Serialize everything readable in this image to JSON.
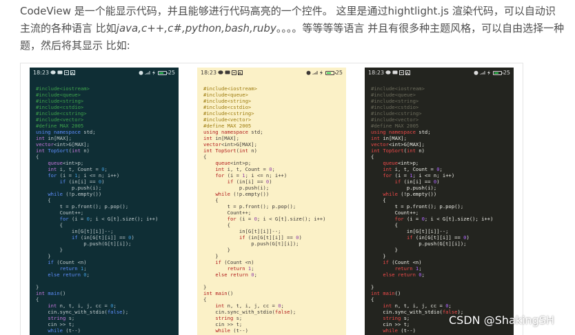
{
  "intro": {
    "line1": "CodeView 是一个能显示代码，并且能够进行代码高亮的一个控件。 这里是通过hightlight.js 渲染代码，可以自动识",
    "line2_start": "主流的各种语言 比如",
    "line2_langs": "java,c++,c#,python,bash,ruby",
    "line2_end": "。。。。等等等等语言 并且有很多种主题风格，可以自由选择一种",
    "line3": "题，然后将其显示 比如:"
  },
  "statusbar": {
    "time": "18:23",
    "battery": "25"
  },
  "code_lines": [
    [
      [
        "pp",
        "#include<iostream>"
      ]
    ],
    [
      [
        "pp",
        "#include<queue>"
      ]
    ],
    [
      [
        "pp",
        "#include<string>"
      ]
    ],
    [
      [
        "pp",
        "#include<cstdio>"
      ]
    ],
    [
      [
        "pp",
        "#include<cstring>"
      ]
    ],
    [
      [
        "pp",
        "#include<vector>"
      ]
    ],
    [
      [
        "pp",
        "#define MAX 2005"
      ]
    ],
    [
      [
        "kw",
        "using namespace "
      ],
      [
        "pl",
        "std;"
      ]
    ],
    [
      [
        "ty",
        "int "
      ],
      [
        "pl",
        "in[MAX];"
      ]
    ],
    [
      [
        "ty",
        "vector"
      ],
      [
        "pl",
        "<int>G[MAX];"
      ]
    ],
    [
      [
        "ty",
        "int "
      ],
      [
        "fn",
        "TopSort"
      ],
      [
        "pl",
        "("
      ],
      [
        "ty",
        "int "
      ],
      [
        "pl",
        "n)"
      ]
    ],
    [
      [
        "pl",
        "{"
      ]
    ],
    [
      [
        "pl",
        "    "
      ],
      [
        "ty",
        "queue"
      ],
      [
        "pl",
        "<int>p;"
      ]
    ],
    [
      [
        "pl",
        "    "
      ],
      [
        "ty",
        "int "
      ],
      [
        "pl",
        "i, t, Count = "
      ],
      [
        "nm",
        "0"
      ],
      [
        "pl",
        ";"
      ]
    ],
    [
      [
        "pl",
        "    "
      ],
      [
        "kw",
        "for "
      ],
      [
        "pl",
        "(i = "
      ],
      [
        "nm",
        "1"
      ],
      [
        "pl",
        "; i <= n; i++)"
      ]
    ],
    [
      [
        "pl",
        "        "
      ],
      [
        "kw",
        "if "
      ],
      [
        "pl",
        "(in[i] == "
      ],
      [
        "nm",
        "0"
      ],
      [
        "pl",
        ")"
      ]
    ],
    [
      [
        "pl",
        "            p.push(i);"
      ]
    ],
    [
      [
        "pl",
        "    "
      ],
      [
        "kw",
        "while "
      ],
      [
        "pl",
        "(!p.empty())"
      ]
    ],
    [
      [
        "pl",
        "    {"
      ]
    ],
    [
      [
        "pl",
        "        t = p.front(); p.pop();"
      ]
    ],
    [
      [
        "pl",
        "        Count++;"
      ]
    ],
    [
      [
        "pl",
        "        "
      ],
      [
        "kw",
        "for "
      ],
      [
        "pl",
        "(i = "
      ],
      [
        "nm",
        "0"
      ],
      [
        "pl",
        "; i < G[t].size(); i++)"
      ]
    ],
    [
      [
        "pl",
        "        {"
      ]
    ],
    [
      [
        "pl",
        "            in[G[t][i]]--;"
      ]
    ],
    [
      [
        "pl",
        "            "
      ],
      [
        "kw",
        "if "
      ],
      [
        "pl",
        "(in[G[t][i]] == "
      ],
      [
        "nm",
        "0"
      ],
      [
        "pl",
        ")"
      ]
    ],
    [
      [
        "pl",
        "                p.push(G[t][i]);"
      ]
    ],
    [
      [
        "pl",
        "        }"
      ]
    ],
    [
      [
        "pl",
        "    }"
      ]
    ],
    [
      [
        "pl",
        "    "
      ],
      [
        "kw",
        "if "
      ],
      [
        "pl",
        "(Count <n)"
      ]
    ],
    [
      [
        "pl",
        "        "
      ],
      [
        "kw",
        "return "
      ],
      [
        "nm",
        "1"
      ],
      [
        "pl",
        ";"
      ]
    ],
    [
      [
        "pl",
        "    "
      ],
      [
        "kw",
        "else return "
      ],
      [
        "nm",
        "0"
      ],
      [
        "pl",
        ";"
      ]
    ],
    [
      [
        "pl",
        ""
      ]
    ],
    [
      [
        "pl",
        "}"
      ]
    ],
    [
      [
        "ty",
        "int "
      ],
      [
        "fn",
        "main"
      ],
      [
        "pl",
        "()"
      ]
    ],
    [
      [
        "pl",
        "{"
      ]
    ],
    [
      [
        "pl",
        "    "
      ],
      [
        "ty",
        "int "
      ],
      [
        "pl",
        "n, t, i, j, cc = "
      ],
      [
        "nm",
        "0"
      ],
      [
        "pl",
        ";"
      ]
    ],
    [
      [
        "pl",
        "    cin.sync_with_stdio("
      ],
      [
        "kw",
        "false"
      ],
      [
        "pl",
        ");"
      ]
    ],
    [
      [
        "pl",
        "    "
      ],
      [
        "ty",
        "string "
      ],
      [
        "pl",
        "s;"
      ]
    ],
    [
      [
        "pl",
        "    cin >> t;"
      ]
    ],
    [
      [
        "pl",
        "    "
      ],
      [
        "kw",
        "while "
      ],
      [
        "pl",
        "(t--)"
      ]
    ]
  ],
  "screenshots": [
    {
      "theme": "dark-teal",
      "background": "#0f2e35"
    },
    {
      "theme": "light-yellow",
      "background": "#fbf1c7"
    },
    {
      "theme": "monokai-dark",
      "background": "#23241f"
    }
  ],
  "watermark": "CSDN @ShakingSH"
}
